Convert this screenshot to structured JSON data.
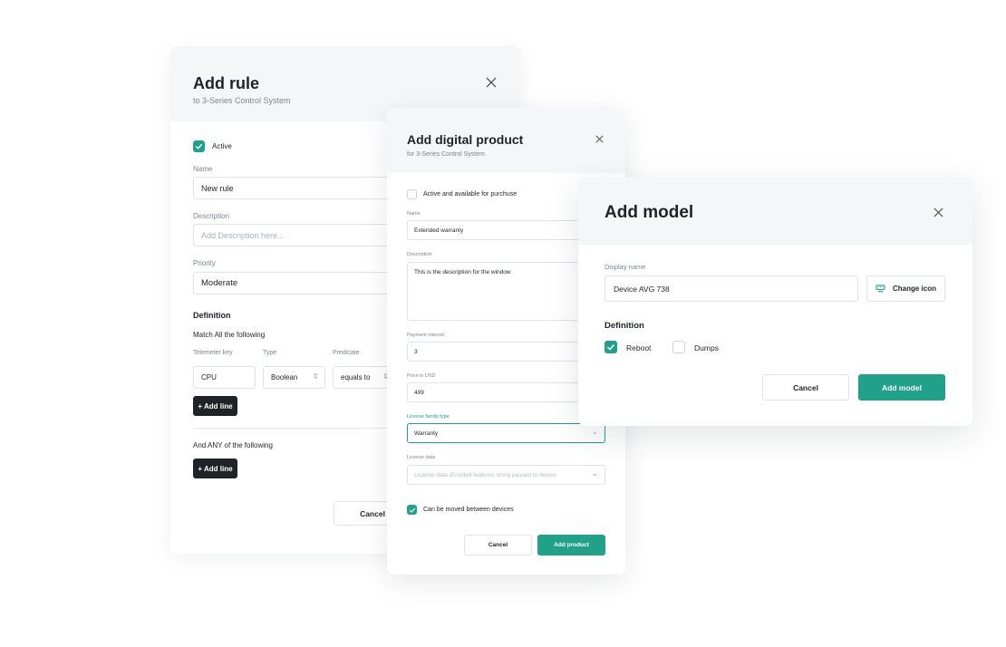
{
  "add_rule": {
    "title": "Add rule",
    "subtitle": "to 3-Series Control System",
    "active_label": "Active",
    "name_label": "Name",
    "name_value": "New rule",
    "description_label": "Description",
    "description_placeholder": "Add Description here...",
    "priority_label": "Priority",
    "priority_value": "Moderate",
    "definition_heading": "Definition",
    "match_all_text": "Match All the following",
    "columns": [
      "Telemeter key",
      "Type",
      "Predicate"
    ],
    "row": {
      "key": "CPU",
      "type": "Boolean",
      "predicate": "equals to"
    },
    "add_line_label": "+ Add line",
    "match_any_text": "And ANY of the following",
    "add_line_label_2": "+ Add line",
    "cancel_label": "Cancel"
  },
  "add_product": {
    "title": "Add digital product",
    "subtitle": "for 3-Series Control System",
    "active_label": "Active and available for purchuse",
    "name_label": "Name",
    "name_value": "Extended warranty",
    "description_label": "Description",
    "description_value": "This is the description for the window",
    "payment_label": "Payment interval",
    "payment_value": "3",
    "price_label": "Price in USD",
    "price_value": "499",
    "license_type_label": "License family type",
    "license_type_value": "Warranty",
    "license_data_label": "License data",
    "license_data_placeholder": "License data (Enoded features string passed to device",
    "movable_label": "Can be moved between devices",
    "cancel_label": "Cancel",
    "submit_label": "Add product"
  },
  "add_model": {
    "title": "Add model",
    "display_name_label": "Display name",
    "display_name_value": "Device AVG 738",
    "change_icon_label": "Change icon",
    "definition_heading": "Definition",
    "reboot_label": "Reboot",
    "reboot_checked": true,
    "dumps_label": "Dumps",
    "dumps_checked": false,
    "cancel_label": "Cancel",
    "submit_label": "Add model"
  },
  "colors": {
    "accent": "#21a08a",
    "dark_button": "#1f2328",
    "header_bg": "#f5f6f7"
  }
}
